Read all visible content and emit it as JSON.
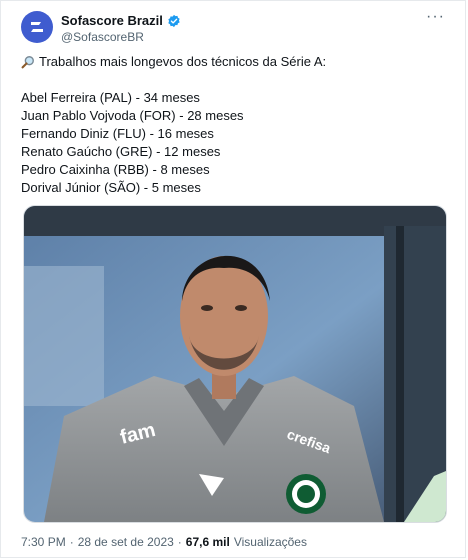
{
  "account": {
    "name": "Sofascore Brazil",
    "handle": "@SofascoreBR",
    "avatar_color": "#3f5ccf",
    "verified_color": "#1d9bf0"
  },
  "tweet": {
    "headline_icon": "magnifying-glass-icon",
    "headline": "Trabalhos mais longevos dos técnicos da Série A:",
    "lines": [
      "Abel Ferreira (PAL) - 34 meses",
      "Juan Pablo Vojvoda (FOR) - 28 meses",
      "Fernando Diniz (FLU) - 16 meses",
      "Renato Gaúcho (GRE) - 12 meses",
      "Pedro Caixinha (RBB) - 8 meses",
      "Dorival Júnior (SÃO) - 5 meses"
    ]
  },
  "media": {
    "shirt_sponsor": "fam",
    "shirt_sleeve": "crefisa"
  },
  "footer": {
    "time": "7:30 PM",
    "separator": "·",
    "date": "28 de set de 2023",
    "views": "67,6 mil",
    "views_label": "Visualizações"
  }
}
